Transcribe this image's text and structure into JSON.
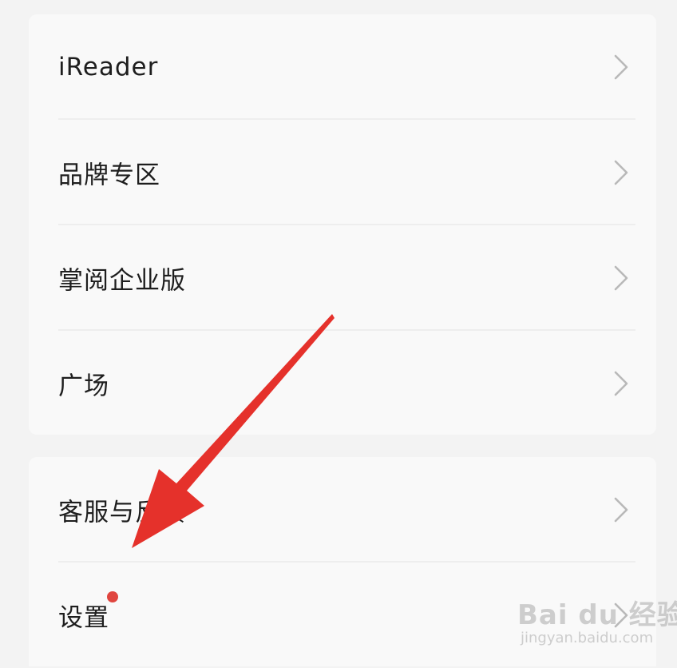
{
  "groups": [
    {
      "items": [
        {
          "label": "iReader"
        },
        {
          "label": "品牌专区"
        },
        {
          "label": "掌阅企业版"
        },
        {
          "label": "广场"
        }
      ]
    },
    {
      "items": [
        {
          "label": "客服与反馈"
        },
        {
          "label": "设置",
          "badge": true
        }
      ]
    }
  ],
  "colors": {
    "background": "#f3f3f3",
    "card": "#f9f9f9",
    "text": "#1e1e1e",
    "chevron": "#b9b9b9",
    "badge": "#e0453f",
    "annotation_arrow": "#e5312b"
  },
  "watermark": {
    "main": "Bai du 经验",
    "sub": "jingyan.baidu.com"
  }
}
